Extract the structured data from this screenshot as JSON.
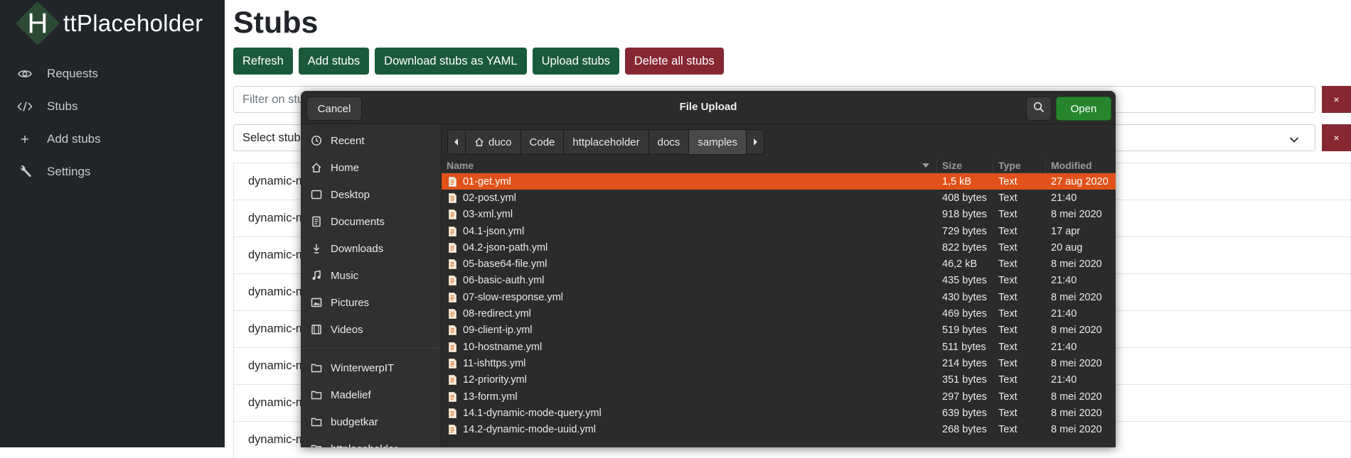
{
  "app": {
    "brand_letter": "H",
    "brand_text": "ttPlaceholder"
  },
  "sidebar": {
    "items": [
      {
        "label": "Requests",
        "icon": "eye-icon"
      },
      {
        "label": "Stubs",
        "icon": "code-icon"
      },
      {
        "label": "Add stubs",
        "icon": "plus-icon"
      },
      {
        "label": "Settings",
        "icon": "wrench-icon"
      }
    ]
  },
  "main": {
    "title": "Stubs",
    "buttons": {
      "refresh": "Refresh",
      "add": "Add stubs",
      "download": "Download stubs as YAML",
      "upload": "Upload stubs",
      "delete_all": "Delete all stubs"
    },
    "filter_placeholder": "Filter on stub",
    "select_placeholder": "Select stub",
    "clear_symbol": "×",
    "stub_rows": [
      "dynamic-m",
      "dynamic-m",
      "dynamic-m",
      "dynamic-m",
      "dynamic-m",
      "dynamic-m",
      "dynamic-m",
      "dynamic-m"
    ]
  },
  "dialog": {
    "title": "File Upload",
    "cancel": "Cancel",
    "open": "Open",
    "places": [
      "Recent",
      "Home",
      "Desktop",
      "Documents",
      "Downloads",
      "Music",
      "Pictures",
      "Videos"
    ],
    "bookmarks": [
      "WinterwerpIT",
      "Madelief",
      "budgetkar",
      "httplaceholder"
    ],
    "path": [
      "duco",
      "Code",
      "httplaceholder",
      "docs",
      "samples"
    ],
    "columns": {
      "name": "Name",
      "size": "Size",
      "type": "Type",
      "modified": "Modified"
    },
    "files": [
      {
        "name": "01-get.yml",
        "size": "1,5 kB",
        "type": "Text",
        "modified": "27 aug 2020",
        "selected": true
      },
      {
        "name": "02-post.yml",
        "size": "408 bytes",
        "type": "Text",
        "modified": "21:40"
      },
      {
        "name": "03-xml.yml",
        "size": "918 bytes",
        "type": "Text",
        "modified": "8 mei 2020"
      },
      {
        "name": "04.1-json.yml",
        "size": "729 bytes",
        "type": "Text",
        "modified": "17 apr"
      },
      {
        "name": "04.2-json-path.yml",
        "size": "822 bytes",
        "type": "Text",
        "modified": "20 aug"
      },
      {
        "name": "05-base64-file.yml",
        "size": "46,2 kB",
        "type": "Text",
        "modified": "8 mei 2020"
      },
      {
        "name": "06-basic-auth.yml",
        "size": "435 bytes",
        "type": "Text",
        "modified": "21:40"
      },
      {
        "name": "07-slow-response.yml",
        "size": "430 bytes",
        "type": "Text",
        "modified": "8 mei 2020"
      },
      {
        "name": "08-redirect.yml",
        "size": "469 bytes",
        "type": "Text",
        "modified": "21:40"
      },
      {
        "name": "09-client-ip.yml",
        "size": "519 bytes",
        "type": "Text",
        "modified": "8 mei 2020"
      },
      {
        "name": "10-hostname.yml",
        "size": "511 bytes",
        "type": "Text",
        "modified": "21:40"
      },
      {
        "name": "11-ishttps.yml",
        "size": "214 bytes",
        "type": "Text",
        "modified": "8 mei 2020"
      },
      {
        "name": "12-priority.yml",
        "size": "351 bytes",
        "type": "Text",
        "modified": "21:40"
      },
      {
        "name": "13-form.yml",
        "size": "297 bytes",
        "type": "Text",
        "modified": "8 mei 2020"
      },
      {
        "name": "14.1-dynamic-mode-query.yml",
        "size": "639 bytes",
        "type": "Text",
        "modified": "8 mei 2020"
      },
      {
        "name": "14.2-dynamic-mode-uuid.yml",
        "size": "268 bytes",
        "type": "Text",
        "modified": "8 mei 2020"
      }
    ]
  },
  "colors": {
    "sidebar_bg": "#212529",
    "button_green": "#1a5a3b",
    "button_red": "#862732",
    "dialog_bg": "#2b2b2b",
    "selection": "#e0521a",
    "open_green": "#26862e"
  }
}
